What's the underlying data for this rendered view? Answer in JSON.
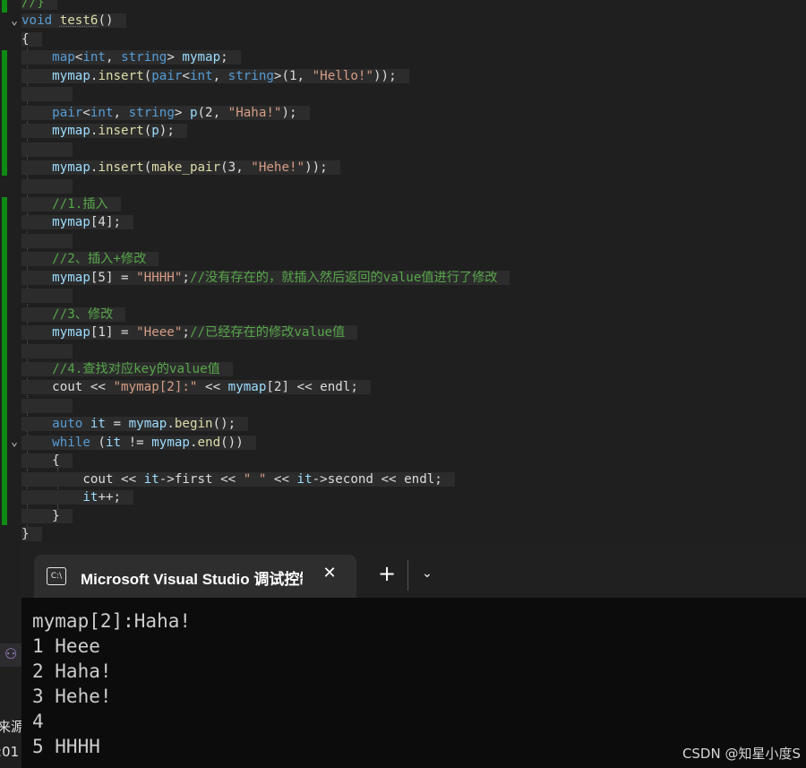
{
  "editor": {
    "lines": [
      [
        {
          "c": "cmt",
          "t": "//}"
        }
      ],
      [
        {
          "c": "kw",
          "t": "void"
        },
        {
          "c": "plain",
          "t": " "
        },
        {
          "c": "fname",
          "t": "test6"
        },
        {
          "c": "plain",
          "t": "()"
        }
      ],
      [
        {
          "c": "plain",
          "t": "{"
        }
      ],
      [
        {
          "c": "plain",
          "t": "    "
        },
        {
          "c": "kw",
          "t": "map"
        },
        {
          "c": "plain",
          "t": "<"
        },
        {
          "c": "kw",
          "t": "int"
        },
        {
          "c": "plain",
          "t": ", "
        },
        {
          "c": "kw",
          "t": "string"
        },
        {
          "c": "plain",
          "t": "> "
        },
        {
          "c": "var",
          "t": "mymap"
        },
        {
          "c": "plain",
          "t": ";"
        }
      ],
      [
        {
          "c": "plain",
          "t": "    "
        },
        {
          "c": "var",
          "t": "mymap"
        },
        {
          "c": "plain",
          "t": "."
        },
        {
          "c": "fn",
          "t": "insert"
        },
        {
          "c": "plain",
          "t": "("
        },
        {
          "c": "kw",
          "t": "pair"
        },
        {
          "c": "plain",
          "t": "<"
        },
        {
          "c": "kw",
          "t": "int"
        },
        {
          "c": "plain",
          "t": ", "
        },
        {
          "c": "kw",
          "t": "string"
        },
        {
          "c": "plain",
          "t": ">(1, "
        },
        {
          "c": "str",
          "t": "\"Hello!\""
        },
        {
          "c": "plain",
          "t": "));"
        }
      ],
      [],
      [
        {
          "c": "plain",
          "t": "    "
        },
        {
          "c": "kw",
          "t": "pair"
        },
        {
          "c": "plain",
          "t": "<"
        },
        {
          "c": "kw",
          "t": "int"
        },
        {
          "c": "plain",
          "t": ", "
        },
        {
          "c": "kw",
          "t": "string"
        },
        {
          "c": "plain",
          "t": "> "
        },
        {
          "c": "var",
          "t": "p"
        },
        {
          "c": "plain",
          "t": "(2, "
        },
        {
          "c": "str",
          "t": "\"Haha!\""
        },
        {
          "c": "plain",
          "t": ");"
        }
      ],
      [
        {
          "c": "plain",
          "t": "    "
        },
        {
          "c": "var",
          "t": "mymap"
        },
        {
          "c": "plain",
          "t": "."
        },
        {
          "c": "fn",
          "t": "insert"
        },
        {
          "c": "plain",
          "t": "("
        },
        {
          "c": "var",
          "t": "p"
        },
        {
          "c": "plain",
          "t": ");"
        }
      ],
      [],
      [
        {
          "c": "plain",
          "t": "    "
        },
        {
          "c": "var",
          "t": "mymap"
        },
        {
          "c": "plain",
          "t": "."
        },
        {
          "c": "fn",
          "t": "insert"
        },
        {
          "c": "plain",
          "t": "("
        },
        {
          "c": "fn",
          "t": "make_pair"
        },
        {
          "c": "plain",
          "t": "(3, "
        },
        {
          "c": "str",
          "t": "\"Hehe!\""
        },
        {
          "c": "plain",
          "t": "));"
        }
      ],
      [],
      [
        {
          "c": "plain",
          "t": "    "
        },
        {
          "c": "cmt",
          "t": "//1.插入"
        }
      ],
      [
        {
          "c": "plain",
          "t": "    "
        },
        {
          "c": "var",
          "t": "mymap"
        },
        {
          "c": "plain",
          "t": "[4];"
        }
      ],
      [],
      [
        {
          "c": "plain",
          "t": "    "
        },
        {
          "c": "cmt",
          "t": "//2、插入+修改"
        }
      ],
      [
        {
          "c": "plain",
          "t": "    "
        },
        {
          "c": "var",
          "t": "mymap"
        },
        {
          "c": "plain",
          "t": "[5] = "
        },
        {
          "c": "str",
          "t": "\"HHHH\""
        },
        {
          "c": "plain",
          "t": ";"
        },
        {
          "c": "cmt",
          "t": "//没有存在的，就插入然后返回的value值进行了修改"
        }
      ],
      [],
      [
        {
          "c": "plain",
          "t": "    "
        },
        {
          "c": "cmt",
          "t": "//3、修改"
        }
      ],
      [
        {
          "c": "plain",
          "t": "    "
        },
        {
          "c": "var",
          "t": "mymap"
        },
        {
          "c": "plain",
          "t": "[1] = "
        },
        {
          "c": "str",
          "t": "\"Heee\""
        },
        {
          "c": "plain",
          "t": ";"
        },
        {
          "c": "cmt",
          "t": "//已经存在的修改value值"
        }
      ],
      [],
      [
        {
          "c": "plain",
          "t": "    "
        },
        {
          "c": "cmt",
          "t": "//4.查找对应key的value值"
        }
      ],
      [
        {
          "c": "plain",
          "t": "    "
        },
        {
          "c": "plain",
          "t": "cout << "
        },
        {
          "c": "str",
          "t": "\"mymap[2]:\""
        },
        {
          "c": "plain",
          "t": " << "
        },
        {
          "c": "var",
          "t": "mymap"
        },
        {
          "c": "plain",
          "t": "[2] << endl;"
        }
      ],
      [],
      [
        {
          "c": "plain",
          "t": "    "
        },
        {
          "c": "kw",
          "t": "auto"
        },
        {
          "c": "plain",
          "t": " "
        },
        {
          "c": "var",
          "t": "it"
        },
        {
          "c": "plain",
          "t": " = "
        },
        {
          "c": "var",
          "t": "mymap"
        },
        {
          "c": "plain",
          "t": "."
        },
        {
          "c": "fn",
          "t": "begin"
        },
        {
          "c": "plain",
          "t": "();"
        }
      ],
      [
        {
          "c": "plain",
          "t": "    "
        },
        {
          "c": "kw",
          "t": "while"
        },
        {
          "c": "plain",
          "t": " ("
        },
        {
          "c": "var",
          "t": "it"
        },
        {
          "c": "plain",
          "t": " != "
        },
        {
          "c": "var",
          "t": "mymap"
        },
        {
          "c": "plain",
          "t": "."
        },
        {
          "c": "fn",
          "t": "end"
        },
        {
          "c": "plain",
          "t": "())"
        }
      ],
      [
        {
          "c": "plain",
          "t": "    {"
        }
      ],
      [
        {
          "c": "plain",
          "t": "        cout << "
        },
        {
          "c": "var",
          "t": "it"
        },
        {
          "c": "plain",
          "t": "->first << "
        },
        {
          "c": "str",
          "t": "\" \""
        },
        {
          "c": "plain",
          "t": " << "
        },
        {
          "c": "var",
          "t": "it"
        },
        {
          "c": "plain",
          "t": "->second << endl;"
        }
      ],
      [
        {
          "c": "plain",
          "t": "        "
        },
        {
          "c": "var",
          "t": "it"
        },
        {
          "c": "plain",
          "t": "++;"
        }
      ],
      [
        {
          "c": "plain",
          "t": "    }"
        }
      ],
      [
        {
          "c": "plain",
          "t": "}"
        }
      ]
    ],
    "side_chars": [
      "来源",
      ":01"
    ]
  },
  "terminal": {
    "tab_title": "Microsoft Visual Studio 调试控制台",
    "tab_icon_text": "C:\\",
    "close_glyph": "✕",
    "new_tab_glyph": "+",
    "dropdown_glyph": "⌄",
    "output": [
      "mymap[2]:Haha!",
      "1 Heee",
      "2 Haha!",
      "3 Hehe!",
      "4",
      "5 HHHH"
    ]
  },
  "watermark": "CSDN @知星小度S",
  "colors": {
    "keyword": "#569cd6",
    "function": "#dcdcaa",
    "variable": "#9cdcfe",
    "string": "#d69d85",
    "comment": "#57a64a",
    "change_bar": "#0f8a14"
  }
}
